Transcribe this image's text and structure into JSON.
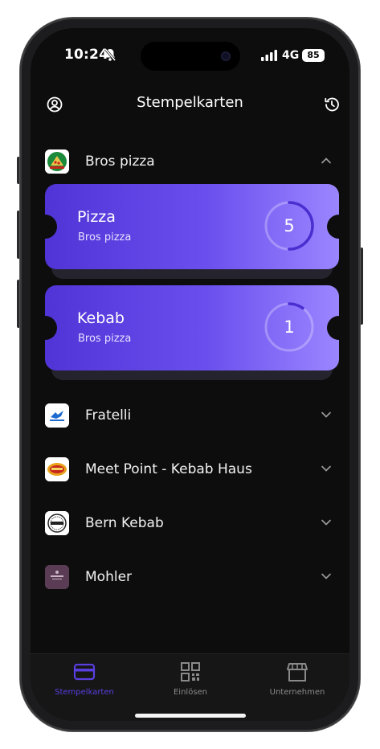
{
  "status_bar": {
    "time": "10:24",
    "network": "4G",
    "battery": "85"
  },
  "header": {
    "title": "Stempelkarten",
    "left_icon": "profile-icon",
    "right_icon": "history-icon"
  },
  "companies": [
    {
      "name": "Bros pizza",
      "expanded": true,
      "logo_color": "#1b8a3a"
    },
    {
      "name": "Fratelli",
      "expanded": false,
      "logo_color": "#1e6ccf"
    },
    {
      "name": "Meet Point - Kebab Haus",
      "expanded": false,
      "logo_color": "#c7261c"
    },
    {
      "name": "Bern Kebab",
      "expanded": false,
      "logo_color": "#222222"
    },
    {
      "name": "Mohler",
      "expanded": false,
      "logo_color": "#5a3c55"
    }
  ],
  "cards": [
    {
      "title": "Pizza",
      "company": "Bros pizza",
      "stamps": "5",
      "progress": 0.5
    },
    {
      "title": "Kebab",
      "company": "Bros pizza",
      "stamps": "1",
      "progress": 0.1
    }
  ],
  "tabs": [
    {
      "label": "Stempelkarten",
      "icon": "card-icon",
      "active": true
    },
    {
      "label": "Einlösen",
      "icon": "qr-code-icon",
      "active": false
    },
    {
      "label": "Unternehmen",
      "icon": "store-icon",
      "active": false
    }
  ],
  "colors": {
    "accent": "#5a3fe0",
    "background": "#0d0d0d",
    "card_gradient_start": "#5134d6",
    "card_gradient_end": "#9b86ff"
  }
}
